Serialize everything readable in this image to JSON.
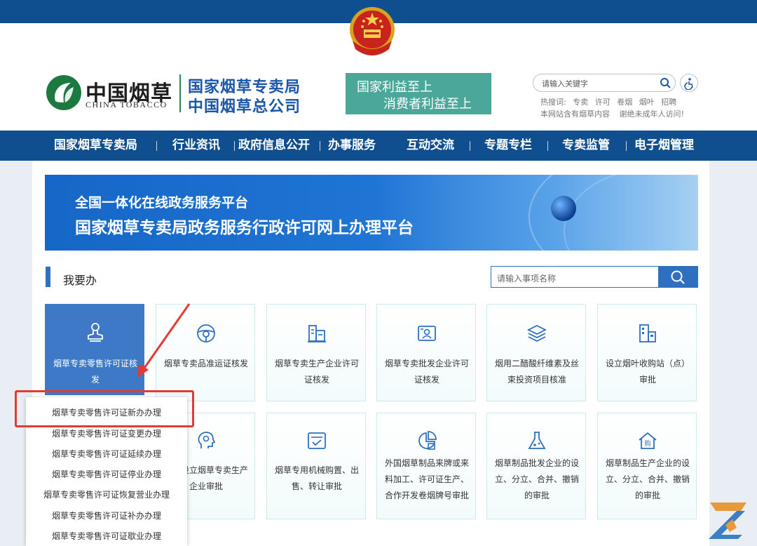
{
  "header": {
    "logo_cn": "中国烟草",
    "logo_en": "CHINA TOBACCO",
    "org_line1": "国家烟草专卖局",
    "org_line2": "中国烟草总公司",
    "slogan_line1": "国家利益至上",
    "slogan_line2": "消费者利益至上",
    "search_placeholder": "请输入关键字",
    "hot_label": "热搜词:",
    "hot_words": [
      "专卖",
      "许可",
      "卷烟",
      "烟叶",
      "招聘"
    ],
    "notice1": "本网站含有烟草内容",
    "notice2": "谢绝未成年人访问!"
  },
  "nav": {
    "items": [
      "国家烟草专卖局",
      "行业资讯",
      "政府信息公开",
      "办事服务",
      "互动交流",
      "专题专栏",
      "专卖监管",
      "电子烟管理"
    ]
  },
  "banner": {
    "line1": "全国一体化在线政务服务平台",
    "line2": "国家烟草专卖局政务服务行政许可网上办理平台"
  },
  "section": {
    "title": "我要办",
    "search_placeholder": "请输入事项名称"
  },
  "cards": [
    {
      "label": "烟草专卖零售许可证核发",
      "icon": "stamp-icon",
      "active": true
    },
    {
      "label": "烟草专卖品准运证核发",
      "icon": "steering-wheel-icon"
    },
    {
      "label": "烟草专卖生产企业许可证核发",
      "icon": "factory-icon"
    },
    {
      "label": "烟草专卖批发企业许可证核发",
      "icon": "id-card-icon"
    },
    {
      "label": "烟用二醋酸纤维素及丝束投资项目核准",
      "icon": "layers-icon"
    },
    {
      "label": "设立烟叶收购站（点）审批",
      "icon": "building-icon"
    },
    {
      "label": "投资设立烟草专卖生产企业审批",
      "icon": "head-gear-icon"
    },
    {
      "label": "烟草专用机械购置、出售、转让审批",
      "icon": "checklist-icon"
    },
    {
      "label": "外国烟草制品来牌或来料加工、许可证生产、合作开发卷烟牌号审批",
      "icon": "pie-chart-icon"
    },
    {
      "label": "烟草制品批发企业的设立、分立、合并、撤销的审批",
      "icon": "flask-icon"
    },
    {
      "label": "烟草制品生产企业的设立、分立、合并、撤销的审批",
      "icon": "purchase-house-icon"
    }
  ],
  "dropdown": {
    "items": [
      "烟草专卖零售许可证新办办理",
      "烟草专卖零售许可证变更办理",
      "烟草专卖零售许可证延续办理",
      "烟草专卖零售许可证停业办理",
      "烟草专卖零售许可证恢复营业办理",
      "烟草专卖零售许可证补办办理",
      "烟草专卖零售许可证歇业办理"
    ]
  },
  "colors": {
    "brand_blue": "#0f4f8f",
    "accent_blue": "#2f6fbf",
    "slogan_green": "#4ba79a",
    "highlight_red": "#e23b33"
  }
}
